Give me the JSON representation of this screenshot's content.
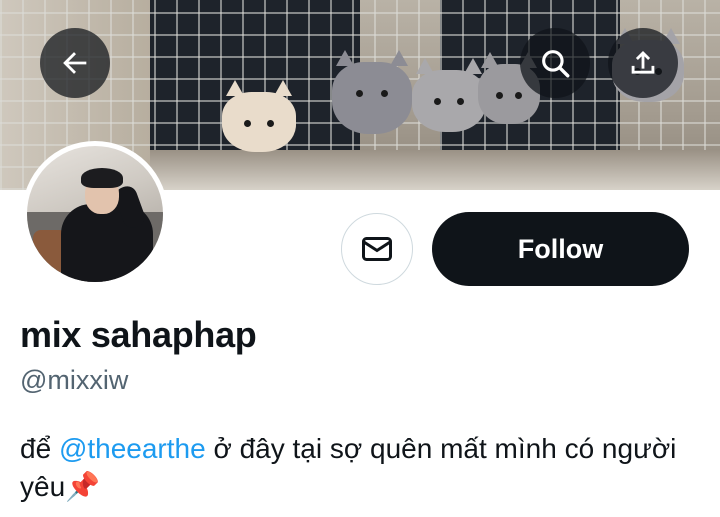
{
  "header": {
    "back_icon": "arrow-left-icon",
    "search_icon": "search-icon",
    "share_icon": "share-upload-icon"
  },
  "profile": {
    "display_name": "mix sahaphap",
    "handle": "@mixxiw",
    "bio_prefix": "để ",
    "bio_mention": "@theearthe",
    "bio_suffix": " ở đây tại sợ quên mất mình có người yêu",
    "bio_emoji": "📌"
  },
  "actions": {
    "message_icon": "envelope-icon",
    "follow_label": "Follow"
  },
  "colors": {
    "text": "#0f1419",
    "secondary_text": "#536471",
    "link": "#1d9bf0",
    "follow_bg": "#0f1419"
  }
}
